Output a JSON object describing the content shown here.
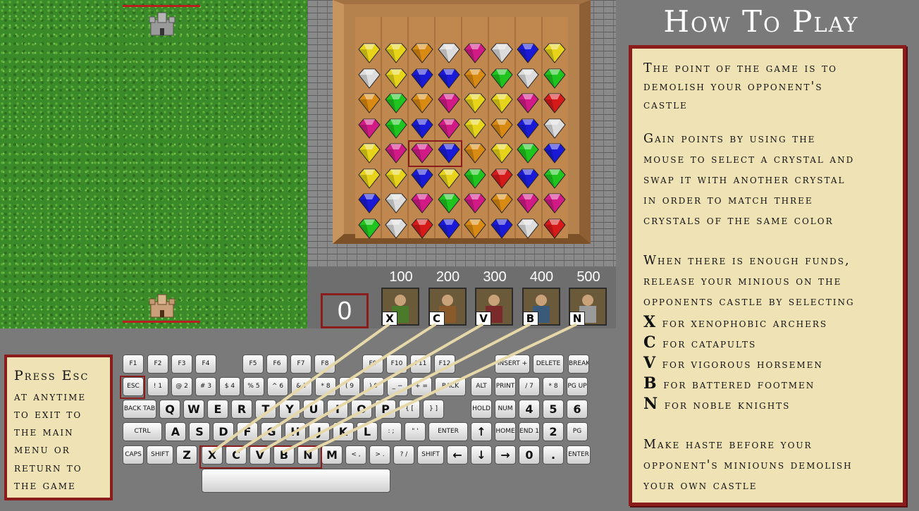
{
  "colors": {
    "accent": "#8a1c1c",
    "panel": "#efe2b5",
    "line": "#e6d8a8"
  },
  "score": "0",
  "units": [
    {
      "price": "100",
      "key": "X",
      "name": "archer"
    },
    {
      "price": "200",
      "key": "C",
      "name": "catapult"
    },
    {
      "price": "300",
      "key": "V",
      "name": "horseman"
    },
    {
      "price": "400",
      "key": "B",
      "name": "footman"
    },
    {
      "price": "500",
      "key": "N",
      "name": "knight"
    }
  ],
  "board": [
    [
      "Y",
      "Y",
      "O",
      "W",
      "M",
      "W",
      "B",
      "Y"
    ],
    [
      "W",
      "Y",
      "B",
      "B",
      "O",
      "G",
      "W",
      "G"
    ],
    [
      "O",
      "G",
      "O",
      "M",
      "Y",
      "Y",
      "M",
      "R"
    ],
    [
      "M",
      "G",
      "B",
      "M",
      "Y",
      "O",
      "B",
      "W"
    ],
    [
      "Y",
      "M",
      "M",
      "B",
      "O",
      "Y",
      "G",
      "B"
    ],
    [
      "Y",
      "Y",
      "B",
      "Y",
      "G",
      "R",
      "B",
      "G"
    ],
    [
      "B",
      "W",
      "M",
      "G",
      "M",
      "O",
      "M",
      "M"
    ],
    [
      "G",
      "W",
      "R",
      "B",
      "O",
      "B",
      "W",
      "R"
    ]
  ],
  "gem_colors": {
    "Y": "#e6d31a",
    "O": "#d98a12",
    "W": "#dcdcdc",
    "M": "#d11a86",
    "B": "#1a1ad6",
    "G": "#1fc41f",
    "R": "#d61a1a"
  },
  "howto": {
    "title": "How To Play",
    "lines": [
      "The point of the game is to",
      "demolish your opponent's",
      "castle",
      "Gain points by using the",
      "mouse to select a crystal and",
      "swap it with another crystal",
      "in order to match three",
      "crystals of the same color",
      "When there is enough funds,",
      "release your minious on the",
      "opponents castle by selecting",
      "for xenophobic archers",
      "for catapults",
      "for vigorous horsemen",
      "for battered footmen",
      "for noble knights",
      "Make haste before your",
      "opponent's miniouns demolish",
      "your own castle"
    ],
    "unit_keys": [
      "X",
      "C",
      "V",
      "B",
      "N"
    ]
  },
  "esc": {
    "lines": [
      "Press Esc",
      "at anytime",
      "to exit to",
      "the main",
      "menu or",
      "return to",
      "the game"
    ]
  },
  "keyboard": {
    "row0": [
      "F1",
      "F2",
      "F3",
      "F4",
      "F5",
      "F6",
      "F7",
      "F8",
      "F9",
      "F10",
      "F11",
      "F12",
      "INSERT +",
      "DELETE −",
      "BREAK"
    ],
    "row1": [
      "ESC",
      "! 1",
      "@ 2",
      "# 3",
      "$ 4",
      "% 5",
      "^ 6",
      "& 7",
      "* 8",
      "( 9",
      ") 0",
      "_ −",
      "+ =",
      "BACK SPACE",
      "ALT",
      "PRINT",
      "/ 7",
      "* 8",
      "PG UP 9"
    ],
    "row2": [
      "BACK TAB TAB",
      "Q",
      "W",
      "E",
      "R",
      "T",
      "Y",
      "U",
      "I",
      "O",
      "P",
      "{ [",
      "} ]",
      "HOLD",
      "NUM LOCK",
      "4",
      "5",
      "6"
    ],
    "row3": [
      "CTRL",
      "A",
      "S",
      "D",
      "F",
      "G",
      "H",
      "J",
      "K",
      "L",
      ": ;",
      "\" '",
      "ENTER",
      "↑",
      "HOME",
      "END 1",
      "2",
      "PG DN 3"
    ],
    "row4": [
      "CAPS",
      "SHIFT",
      "Z",
      "X",
      "C",
      "V",
      "B",
      "N",
      "M",
      "< ,",
      "> .",
      "? /",
      "SHIFT",
      "←",
      "↓",
      "→",
      "0",
      ".",
      "ENTER"
    ]
  }
}
